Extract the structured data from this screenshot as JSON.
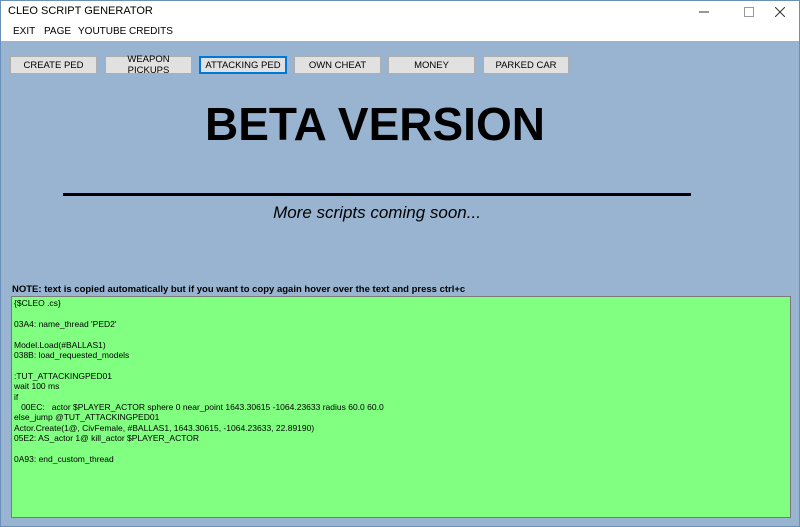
{
  "window": {
    "title": "CLEO SCRIPT GENERATOR"
  },
  "menu": [
    {
      "label": "EXIT"
    },
    {
      "label": "PAGE"
    },
    {
      "label": "YOUTUBE"
    },
    {
      "label": "CREDITS"
    }
  ],
  "toolbar": [
    {
      "label": "CREATE PED"
    },
    {
      "label": "WEAPON PICKUPS"
    },
    {
      "label": "ATTACKING PED"
    },
    {
      "label": "OWN CHEAT"
    },
    {
      "label": "MONEY"
    },
    {
      "label": "PARKED CAR"
    }
  ],
  "banner": {
    "title": "BETA VERSION",
    "subtitle": "More scripts coming soon..."
  },
  "note": "NOTE: text is copied automatically but if you want to copy again hover over the text and press ctrl+c",
  "code_lines": [
    "{$CLEO .cs}",
    "",
    "03A4: name_thread 'PED2'",
    "",
    "Model.Load(#BALLAS1)",
    "038B: load_requested_models",
    "",
    ":TUT_ATTACKINGPED01",
    "wait 100 ms",
    "if",
    "   00EC:   actor $PLAYER_ACTOR sphere 0 near_point 1643.30615 -1064.23633 radius 60.0 60.0",
    "else_jump @TUT_ATTACKINGPED01",
    "Actor.Create(1@, CivFemale, #BALLAS1, 1643.30615, -1064.23633, 22.89190)",
    "05E2: AS_actor 1@ kill_actor $PLAYER_ACTOR",
    "",
    "0A93: end_custom_thread"
  ]
}
